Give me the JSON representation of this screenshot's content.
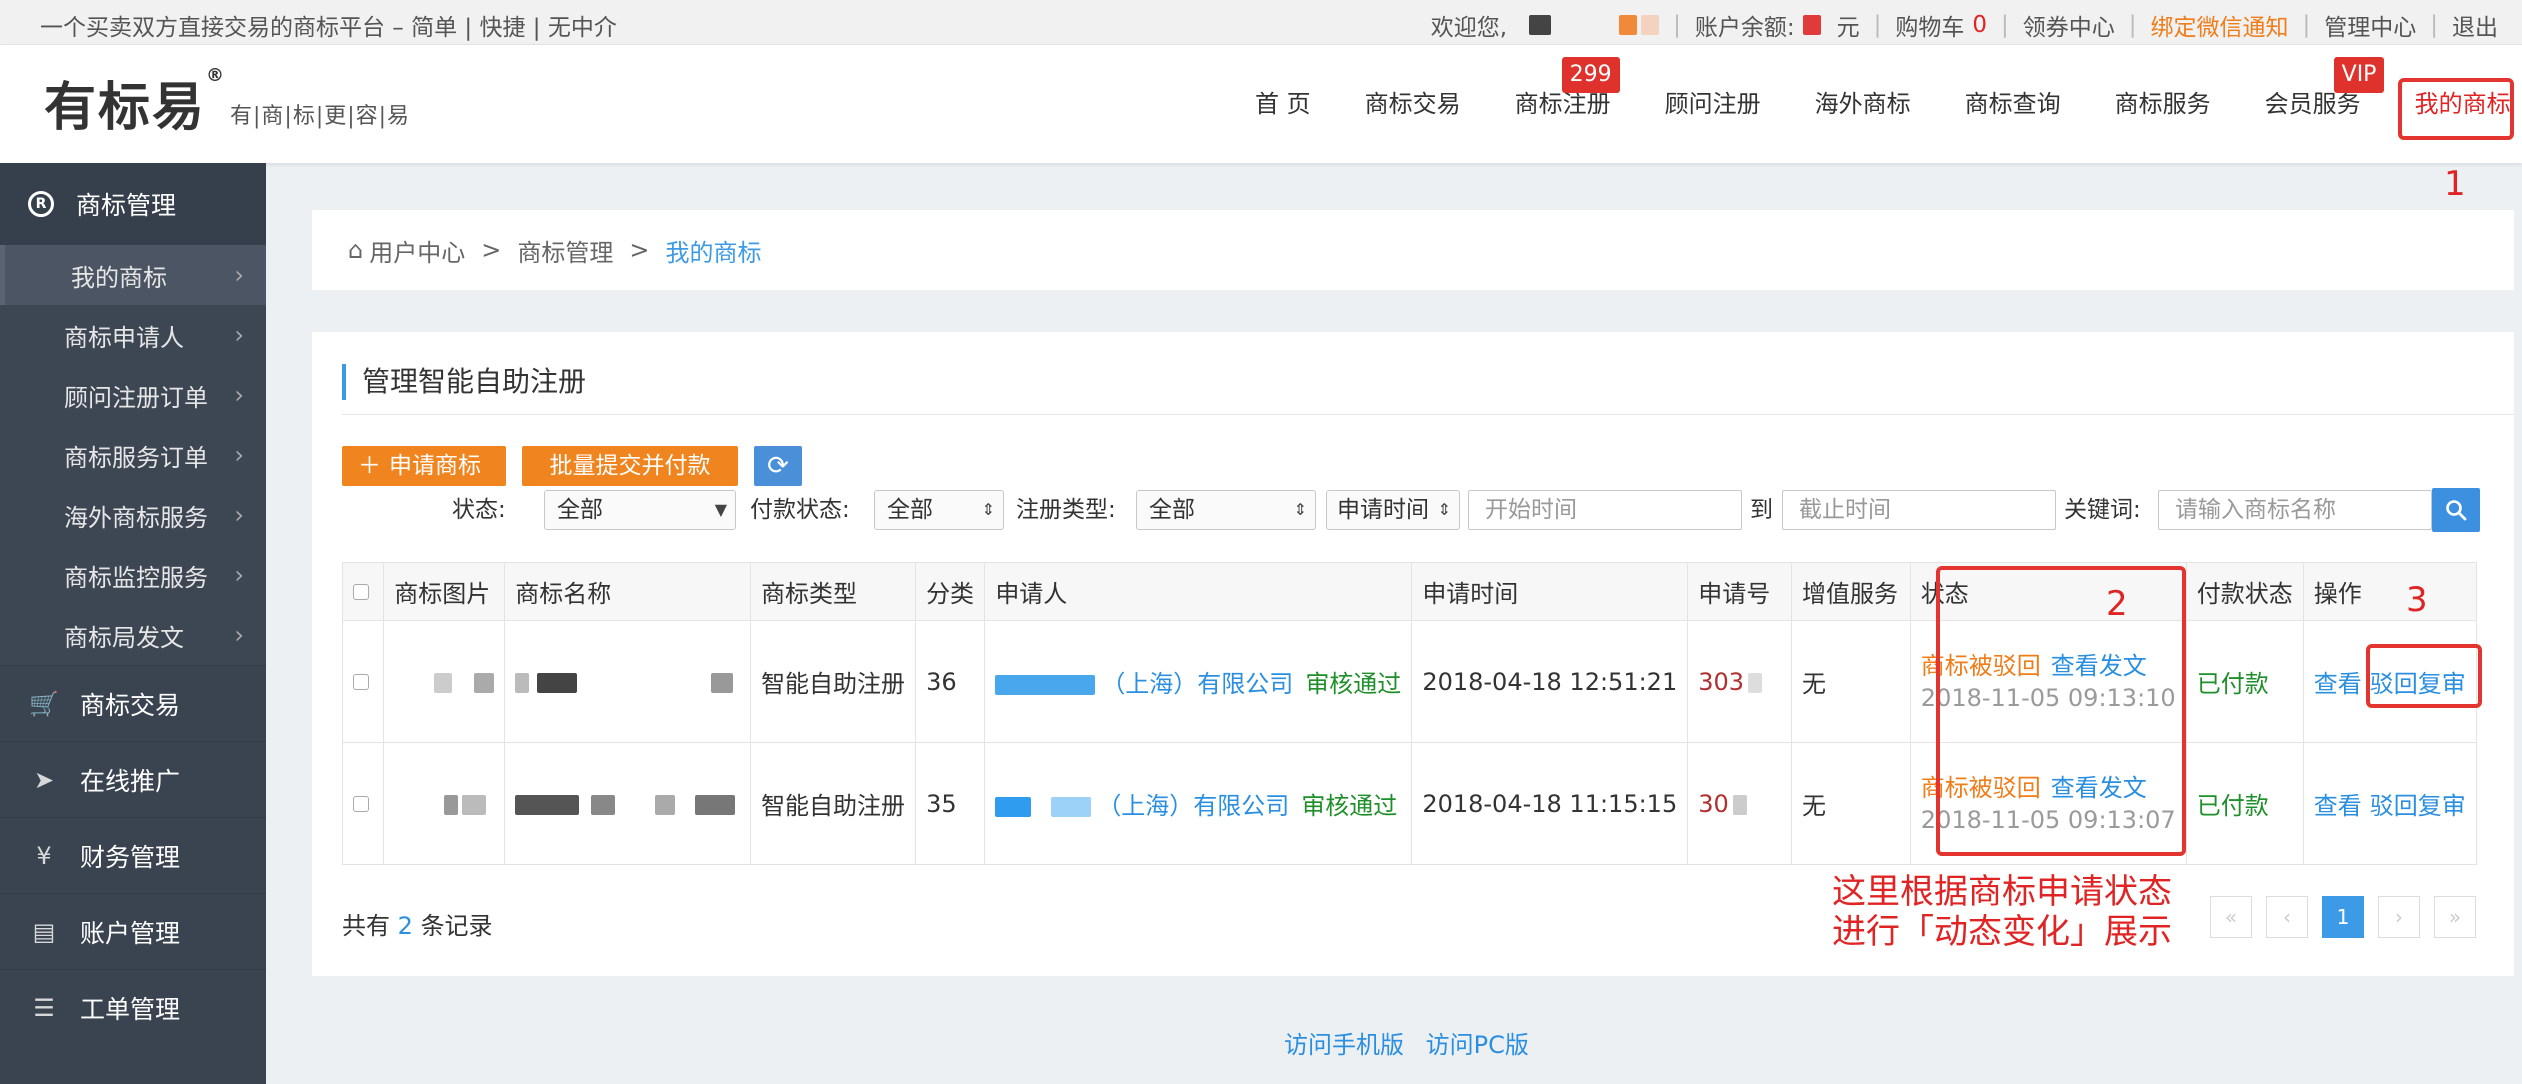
{
  "topbar": {
    "slogan": "一个买卖双方直接交易的商标平台 – 简单 | 快捷 | 无中介",
    "welcome": "欢迎您,",
    "balance_label": "账户余额:",
    "balance_unit": "元",
    "cart_label": "购物车",
    "cart_count": "0",
    "coupon": "领券中心",
    "wechat": "绑定微信通知",
    "admin": "管理中心",
    "logout": "退出"
  },
  "header": {
    "logo": "有标易",
    "logo_sub": "有|商|标|更|容|易",
    "nav": [
      {
        "label": "首 页"
      },
      {
        "label": "商标交易"
      },
      {
        "label": "商标注册",
        "badge": "299"
      },
      {
        "label": "顾问注册"
      },
      {
        "label": "海外商标"
      },
      {
        "label": "商标查询"
      },
      {
        "label": "商标服务"
      },
      {
        "label": "会员服务",
        "badge": "VIP"
      },
      {
        "label": "我的商标"
      }
    ]
  },
  "annotations": {
    "n1": "1",
    "n2": "2",
    "n3": "3",
    "note_line1": "这里根据商标申请状态",
    "note_line2": "进行「动态变化」展示"
  },
  "sidebar": {
    "head": "商标管理",
    "subs": [
      "我的商标",
      "商标申请人",
      "顾问注册订单",
      "商标服务订单",
      "海外商标服务",
      "商标监控服务",
      "商标局发文"
    ],
    "mains": [
      {
        "label": "商标交易",
        "icon": "cart-icon"
      },
      {
        "label": "在线推广",
        "icon": "send-icon"
      },
      {
        "label": "财务管理",
        "icon": "money-icon"
      },
      {
        "label": "账户管理",
        "icon": "account-icon"
      },
      {
        "label": "工单管理",
        "icon": "clipboard-icon"
      }
    ]
  },
  "breadcrumb": {
    "home": "用户中心",
    "mid": "商标管理",
    "current": "我的商标",
    "sep": ">"
  },
  "panel": {
    "title": "管理智能自助注册",
    "apply_btn": "申请商标",
    "batch_btn": "批量提交并付款",
    "filters": {
      "status_label": "状态:",
      "status_value": "全部",
      "pay_label": "付款状态:",
      "pay_value": "全部",
      "type_label": "注册类型:",
      "type_value": "全部",
      "time_select": "申请时间",
      "start_placeholder": "开始时间",
      "to": "到",
      "end_placeholder": "截止时间",
      "keyword_label": "关键词:",
      "keyword_placeholder": "请输入商标名称"
    },
    "columns": [
      "商标图片",
      "商标名称",
      "商标类型",
      "分类",
      "申请人",
      "申请时间",
      "申请号",
      "增值服务",
      "状态",
      "付款状态",
      "操作"
    ],
    "rows": [
      {
        "type": "智能自助注册",
        "class": "36",
        "applicant": "（上海）有限公司",
        "audit": "审核通过",
        "time": "2018-04-18 12:51:21",
        "appno": "303",
        "service": "无",
        "status": "商标被驳回",
        "doc": "查看发文",
        "status_time": "2018-11-05 09:13:10",
        "pay": "已付款",
        "view": "查看",
        "review": "驳回复审"
      },
      {
        "type": "智能自助注册",
        "class": "35",
        "applicant": "（上海）有限公司",
        "audit": "审核通过",
        "time": "2018-04-18 11:15:15",
        "appno": "30",
        "service": "无",
        "status": "商标被驳回",
        "doc": "查看发文",
        "status_time": "2018-11-05 09:13:07",
        "pay": "已付款",
        "view": "查看",
        "review": "驳回复审"
      }
    ],
    "total_pre": "共有",
    "total_count": "2",
    "total_post": "条记录",
    "page_current": "1"
  },
  "footer": {
    "mobile": "访问手机版",
    "pc": "访问PC版"
  }
}
